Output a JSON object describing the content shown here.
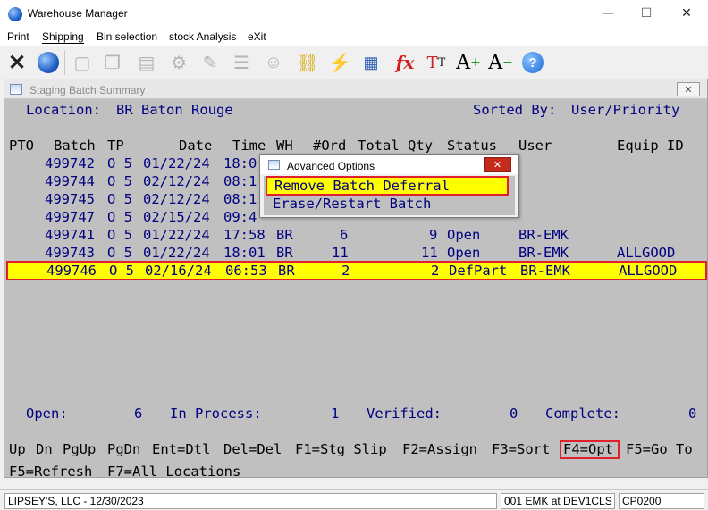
{
  "window": {
    "title": "Warehouse Manager",
    "minimize": "—",
    "maximize": "☐",
    "close": "✕"
  },
  "menu": [
    "Print",
    "Shipping",
    "Bin selection",
    "stock Analysis",
    "eXit"
  ],
  "child": {
    "title": "Staging Batch Summary",
    "close": "✕"
  },
  "header": {
    "location_label": "Location:",
    "location_value": "BR Baton Rouge",
    "sorted_label": "Sorted By:",
    "sorted_value": "User/Priority"
  },
  "columns": [
    "PTO",
    "Batch",
    "TP",
    "Date",
    "Time",
    "WH",
    "#Ord",
    "Total Qty",
    "Status",
    "User",
    "Equip ID"
  ],
  "rows": [
    {
      "pto": "",
      "batch": "499742",
      "tp": "O 5",
      "date": "01/22/24",
      "time": "18:0",
      "wh": "",
      "ord": "",
      "qty": "",
      "status": "",
      "user": "",
      "equip": ""
    },
    {
      "pto": "",
      "batch": "499744",
      "tp": "O 5",
      "date": "02/12/24",
      "time": "08:1",
      "wh": "",
      "ord": "",
      "qty": "",
      "status": "",
      "user": "",
      "equip": ""
    },
    {
      "pto": "",
      "batch": "499745",
      "tp": "O 5",
      "date": "02/12/24",
      "time": "08:1",
      "wh": "",
      "ord": "",
      "qty": "",
      "status": "",
      "user": "",
      "equip": ""
    },
    {
      "pto": "",
      "batch": "499747",
      "tp": "O 5",
      "date": "02/15/24",
      "time": "09:4",
      "wh": "",
      "ord": "",
      "qty": "",
      "status": "",
      "user": "",
      "equip": ""
    },
    {
      "pto": "",
      "batch": "499741",
      "tp": "O 5",
      "date": "01/22/24",
      "time": "17:58",
      "wh": "BR",
      "ord": "6",
      "qty": "9",
      "status": "Open",
      "user": "BR-EMK",
      "equip": ""
    },
    {
      "pto": "",
      "batch": "499743",
      "tp": "O 5",
      "date": "01/22/24",
      "time": "18:01",
      "wh": "BR",
      "ord": "11",
      "qty": "11",
      "status": "Open",
      "user": "BR-EMK",
      "equip": "ALLGOOD"
    },
    {
      "pto": "",
      "batch": "499746",
      "tp": "O 5",
      "date": "02/16/24",
      "time": "06:53",
      "wh": "BR",
      "ord": "2",
      "qty": "2",
      "status": "DefPart",
      "user": "BR-EMK",
      "equip": "ALLGOOD"
    }
  ],
  "summary": {
    "open_label": "Open:",
    "open_value": "6",
    "inprocess_label": "In Process:",
    "inprocess_value": "1",
    "verified_label": "Verified:",
    "verified_value": "0",
    "complete_label": "Complete:",
    "complete_value": "0"
  },
  "fkeys_line1": [
    "Up",
    "Dn",
    "PgUp",
    "PgDn",
    "Ent=Dtl",
    "Del=Del",
    "F1=Stg Slip",
    "F2=Assign",
    "F3=Sort",
    "F4=Opt",
    "F5=Go To"
  ],
  "fkeys_line2": [
    "F5=Refresh",
    "F7=All Locations"
  ],
  "dialog": {
    "title": "Advanced Options",
    "close": "✕",
    "options": [
      "Remove Batch Deferral",
      "Erase/Restart Batch"
    ]
  },
  "statusbar": {
    "company": "LIPSEY'S, LLC - 12/30/2023",
    "user": "001 EMK at DEV1CLS",
    "code": "CP0200"
  },
  "colors": {
    "highlight": "#ffff00",
    "callout": "#e0202a",
    "terminal_text": "#000080",
    "terminal_bg": "#c0c0c0"
  }
}
